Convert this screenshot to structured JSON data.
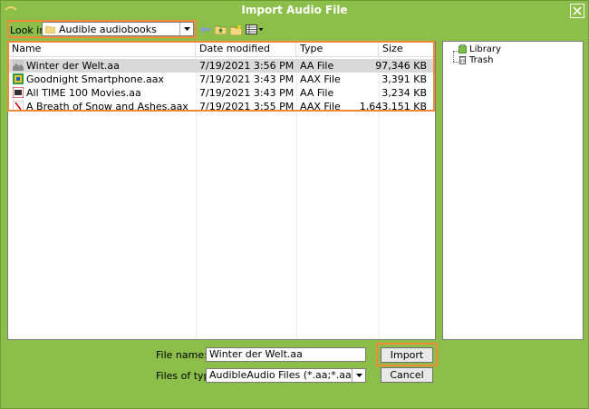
{
  "window": {
    "title": "Import Audio File",
    "close_icon": "close-x-icon"
  },
  "look_in": {
    "label": "Look in:",
    "value": "Audible audiobooks",
    "icon": "folder-icon"
  },
  "toolbar": {
    "buttons": [
      "back-arrow-icon",
      "up-folder-icon",
      "new-folder-icon",
      "view-menu-icon"
    ]
  },
  "file_list": {
    "columns": [
      "Name",
      "Date modified",
      "Type",
      "Size"
    ],
    "rows": [
      {
        "name": "Winter der Welt.aa",
        "date": "7/19/2021 3:56 PM",
        "type": "AA File",
        "size": "97,346 KB",
        "selected": true,
        "icon": "audiobook-cover-icon"
      },
      {
        "name": "Goodnight Smartphone.aax",
        "date": "7/19/2021 3:43 PM",
        "type": "AAX File",
        "size": "3,391 KB",
        "selected": false,
        "icon": "audiobook-cover-icon"
      },
      {
        "name": "All TIME 100 Movies.aa",
        "date": "7/19/2021 3:43 PM",
        "type": "AA File",
        "size": "3,234 KB",
        "selected": false,
        "icon": "audiobook-cover-icon"
      },
      {
        "name": "A Breath of Snow and Ashes.aax",
        "date": "7/19/2021 3:55 PM",
        "type": "AAX File",
        "size": "1,643,151 KB",
        "selected": false,
        "icon": "audiobook-cover-icon"
      }
    ]
  },
  "tree": {
    "items": [
      {
        "label": "Library",
        "icon": "library-icon"
      },
      {
        "label": "Trash",
        "icon": "trash-icon"
      }
    ]
  },
  "form": {
    "file_name_label": "File name:",
    "file_name_value": "Winter der Welt.aa",
    "file_type_label": "Files of type:",
    "file_type_value": "AudibleAudio Files (*.aa;*.aax)",
    "import_label": "Import",
    "cancel_label": "Cancel"
  },
  "colors": {
    "window_bg": "#8cbf4a",
    "highlight": "#f08a3a",
    "selected_row": "#d9d9d9"
  }
}
